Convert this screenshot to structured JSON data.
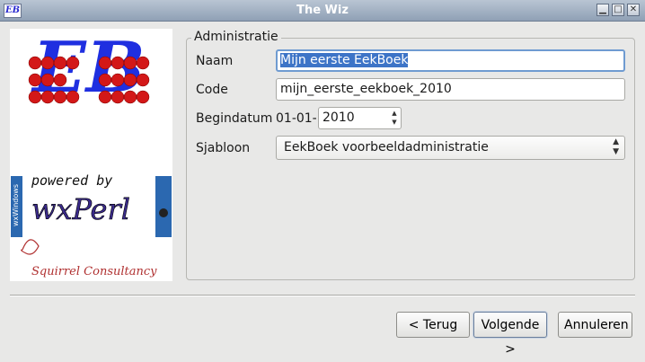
{
  "window": {
    "title": "The Wiz",
    "icon_text": "EB"
  },
  "logo": {
    "eb_letters": "EB",
    "powered_by": "powered by",
    "wxperl": "wxPerl",
    "wxwindows": "wxWindows",
    "squirrel": "Squirrel Consultancy"
  },
  "group": {
    "title": "Administratie"
  },
  "form": {
    "naam_label": "Naam",
    "naam_value": "Mijn eerste EekBoek",
    "code_label": "Code",
    "code_value": "mijn_eerste_eekboek_2010",
    "begindatum_label": "Begindatum",
    "date_prefix": "01-01-",
    "year_value": "2010",
    "sjabloon_label": "Sjabloon",
    "sjabloon_value": "EekBoek voorbeeldadministratie"
  },
  "buttons": {
    "back": "< Terug",
    "next": "Volgende >",
    "cancel": "Annuleren"
  }
}
